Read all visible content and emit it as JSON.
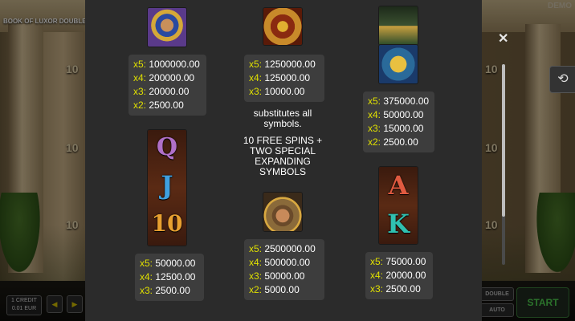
{
  "game": {
    "title": "BOOK OF LUXOR DOUBLE",
    "mode_badge": "DEMO",
    "line_numbers": [
      "10",
      "10",
      "10",
      "10",
      "10",
      "10"
    ]
  },
  "bottom_bar": {
    "credit_label": "1 CREDIT",
    "credit_value": "0.01 EUR",
    "prev_glyph": "◀",
    "next_glyph": "▶",
    "double_label": "DOUBLE",
    "auto_label": "AUTO",
    "start_label": "START"
  },
  "paytable": {
    "close_glyph": "✕",
    "history_glyph": "⟲",
    "pharaoh": [
      {
        "mult": "x5:",
        "value": "1000000.00"
      },
      {
        "mult": "x4:",
        "value": "200000.00"
      },
      {
        "mult": "x3:",
        "value": "20000.00"
      },
      {
        "mult": "x2:",
        "value": "2500.00"
      }
    ],
    "book": [
      {
        "mult": "x5:",
        "value": "1250000.00"
      },
      {
        "mult": "x4:",
        "value": "125000.00"
      },
      {
        "mult": "x3:",
        "value": "10000.00"
      }
    ],
    "book_note_1": "substitutes all symbols.",
    "book_note_2": "10 FREE SPINS + TWO SPECIAL EXPANDING SYMBOLS",
    "anubis_scarab": [
      {
        "mult": "x5:",
        "value": "375000.00"
      },
      {
        "mult": "x4:",
        "value": "50000.00"
      },
      {
        "mult": "x3:",
        "value": "15000.00"
      },
      {
        "mult": "x2:",
        "value": "2500.00"
      }
    ],
    "qj10": [
      {
        "mult": "x5:",
        "value": "50000.00"
      },
      {
        "mult": "x4:",
        "value": "12500.00"
      },
      {
        "mult": "x3:",
        "value": "2500.00"
      }
    ],
    "explorer": [
      {
        "mult": "x5:",
        "value": "2500000.00"
      },
      {
        "mult": "x4:",
        "value": "500000.00"
      },
      {
        "mult": "x3:",
        "value": "50000.00"
      },
      {
        "mult": "x2:",
        "value": "5000.00"
      }
    ],
    "ak": [
      {
        "mult": "x5:",
        "value": "75000.00"
      },
      {
        "mult": "x4:",
        "value": "20000.00"
      },
      {
        "mult": "x3:",
        "value": "2500.00"
      }
    ],
    "card_letters": {
      "q": "Q",
      "j": "J",
      "ten": "10",
      "a": "A",
      "k": "K"
    }
  },
  "colors": {
    "overlay": "#2b2b2b",
    "box": "#3d3d3d",
    "multiplier": "#e0e000",
    "text": "#ffffff"
  }
}
